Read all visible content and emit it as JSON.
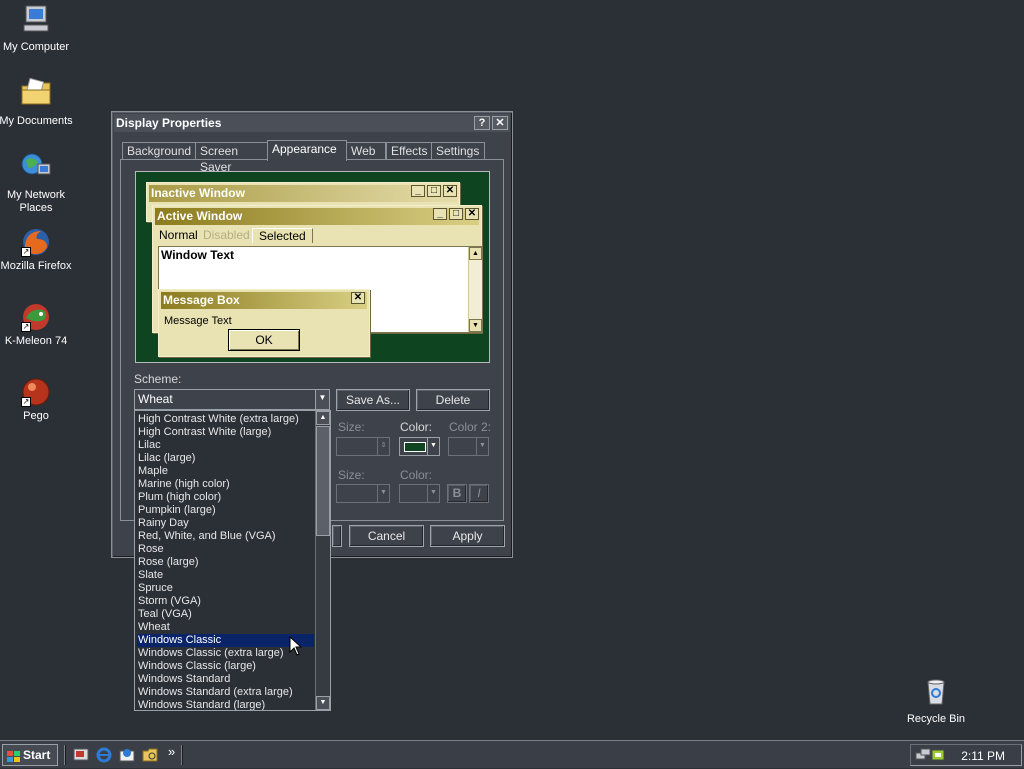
{
  "desktop": {
    "icons": [
      {
        "label": "My Computer"
      },
      {
        "label": "My Documents"
      },
      {
        "label": "My Network Places"
      },
      {
        "label": "Mozilla Firefox"
      },
      {
        "label": "K-Meleon 74"
      },
      {
        "label": "Pego"
      },
      {
        "label": "Recycle Bin"
      }
    ]
  },
  "window": {
    "title": "Display Properties",
    "help_glyph": "?",
    "close_glyph": "✕",
    "tabs": [
      {
        "label": "Background"
      },
      {
        "label": "Screen Saver"
      },
      {
        "label": "Appearance"
      },
      {
        "label": "Web"
      },
      {
        "label": "Effects"
      },
      {
        "label": "Settings"
      }
    ],
    "active_tab": "Appearance"
  },
  "preview": {
    "inactive_title": "Inactive Window",
    "active_title": "Active Window",
    "menu_normal": "Normal",
    "menu_disabled": "Disabled",
    "menu_selected": "Selected",
    "window_text": "Window Text",
    "message_title": "Message Box",
    "message_text": "Message Text",
    "ok_label": "OK",
    "colors": {
      "desktop": "#0f4421",
      "active_title_start": "#8c7b1e",
      "active_title_end": "#d9cf84",
      "inactive_title_start": "#a89a45",
      "inactive_title_end": "#e5ddaa",
      "face": "#e9e3b3"
    }
  },
  "appearance": {
    "scheme_label": "Scheme:",
    "scheme_value": "Wheat",
    "save_as_label": "Save As...",
    "delete_label": "Delete",
    "size_label": "Size:",
    "color_label": "Color:",
    "color2_label": "Color 2:",
    "size_label_2": "Size:",
    "color_label_2": "Color:",
    "bold_label": "B",
    "italic_label": "I",
    "item_color": "#0f4421"
  },
  "scheme_list": {
    "items": [
      "High Contrast White (extra large)",
      "High Contrast White (large)",
      "Lilac",
      "Lilac (large)",
      "Maple",
      "Marine (high color)",
      "Plum (high color)",
      "Pumpkin (large)",
      "Rainy Day",
      "Red, White, and Blue (VGA)",
      "Rose",
      "Rose (large)",
      "Slate",
      "Spruce",
      "Storm (VGA)",
      "Teal (VGA)",
      "Wheat",
      "Windows Classic",
      "Windows Classic (extra large)",
      "Windows Classic (large)",
      "Windows Standard",
      "Windows Standard (extra large)",
      "Windows Standard (large)"
    ],
    "selected": "Windows Classic",
    "selection_color": "#0a246a"
  },
  "dialog_buttons": {
    "cancel_label": "Cancel",
    "apply_label": "Apply"
  },
  "taskbar": {
    "start_label": "Start",
    "chevron": "»",
    "clock": "2:11 PM"
  }
}
